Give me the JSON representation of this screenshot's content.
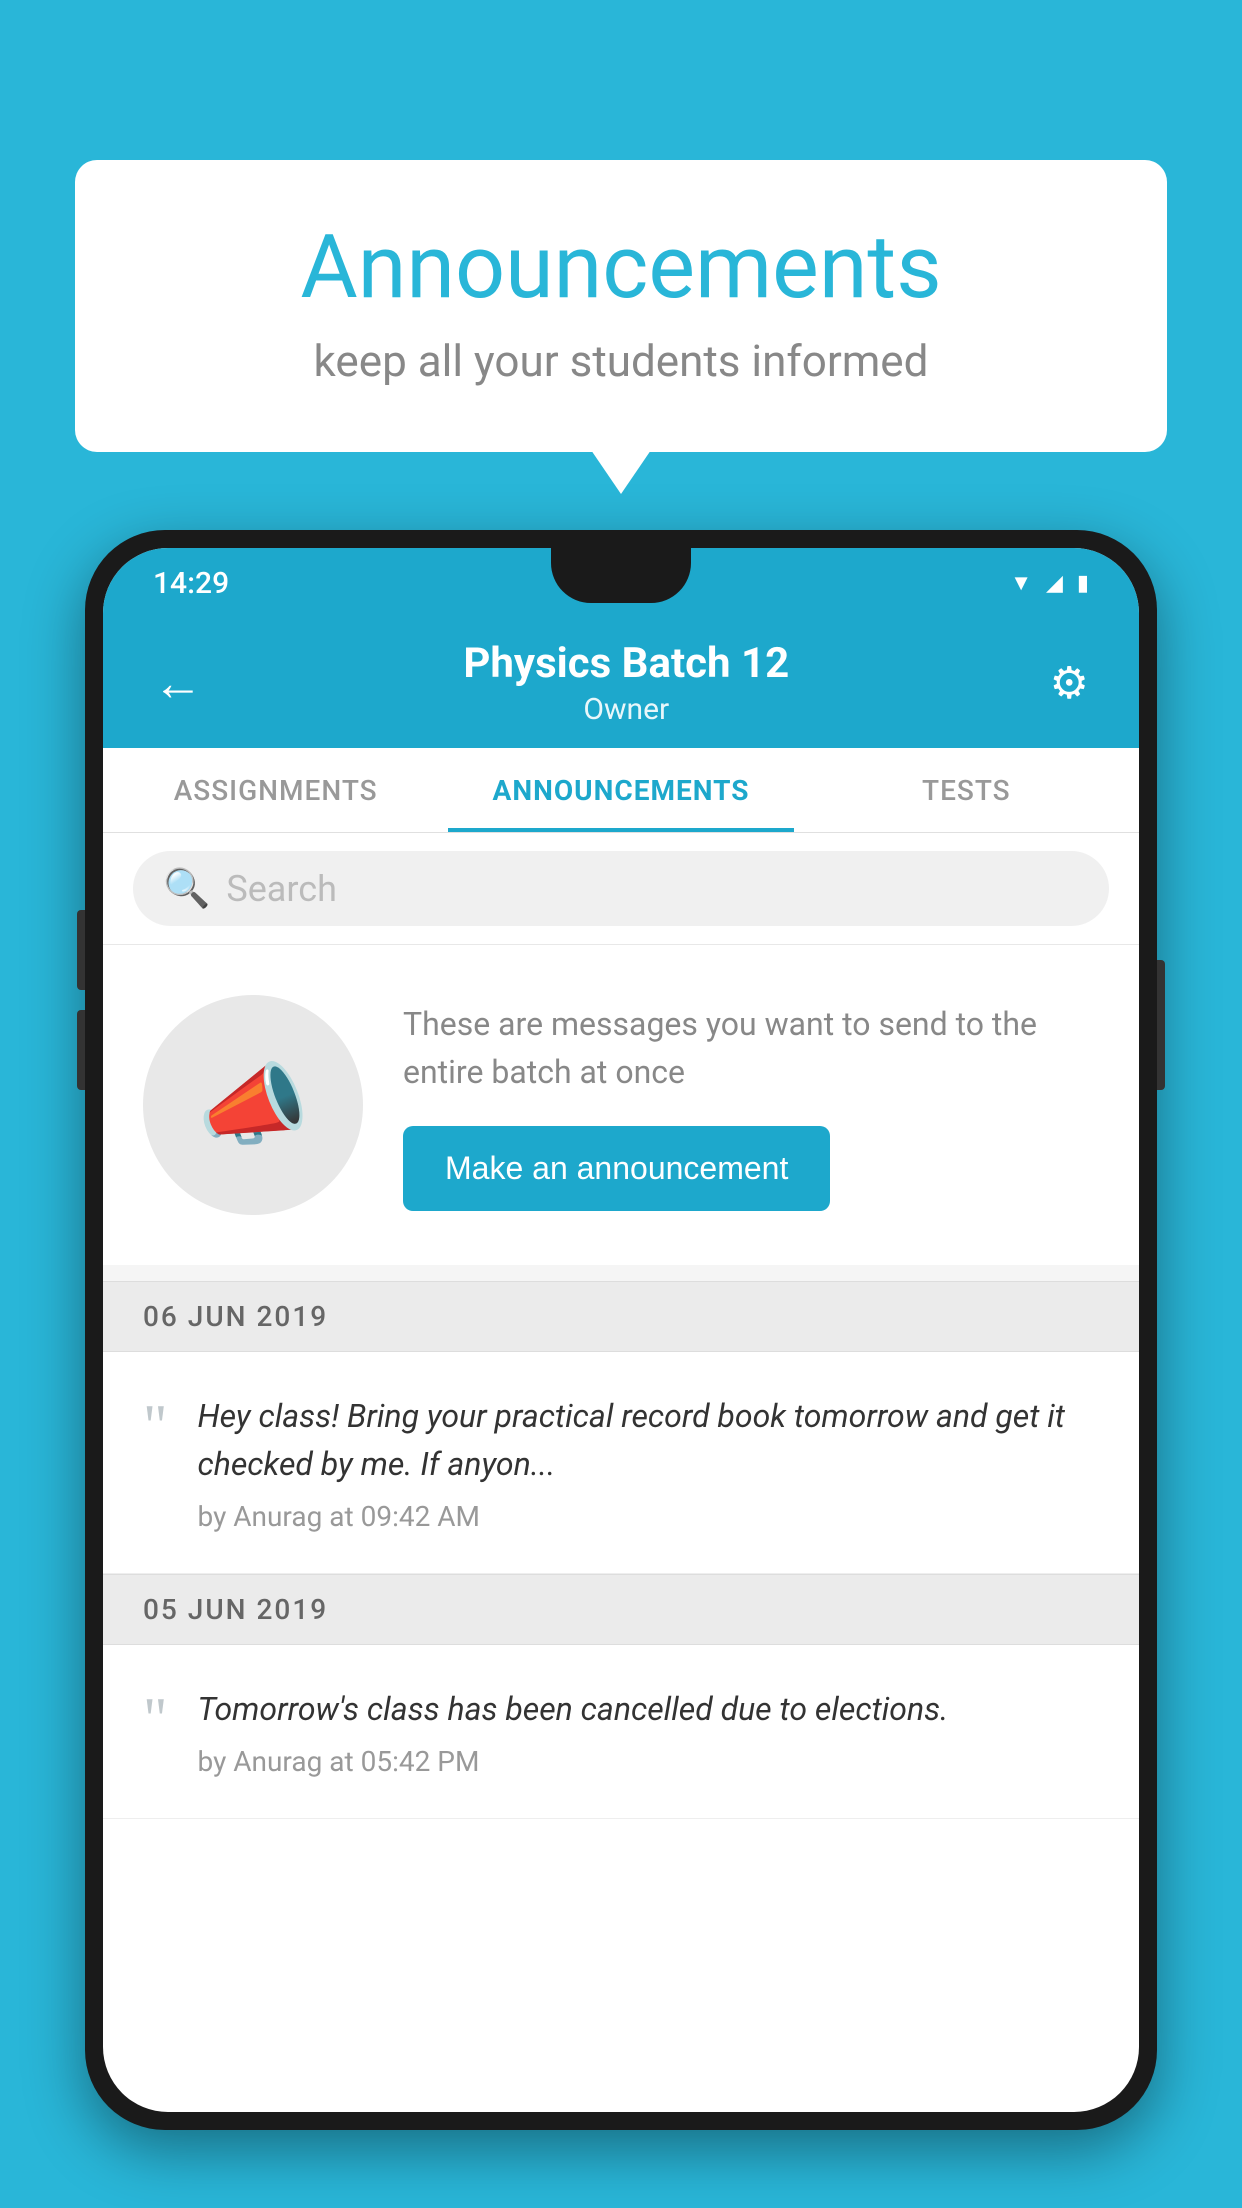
{
  "background_color": "#29b6d8",
  "speech_bubble": {
    "title": "Announcements",
    "subtitle": "keep all your students informed"
  },
  "phone": {
    "status_bar": {
      "time": "14:29",
      "icons": [
        "wifi",
        "signal",
        "battery"
      ]
    },
    "app_bar": {
      "back_label": "←",
      "title": "Physics Batch 12",
      "subtitle": "Owner",
      "settings_label": "⚙"
    },
    "tabs": [
      {
        "label": "ASSIGNMENTS",
        "active": false
      },
      {
        "label": "ANNOUNCEMENTS",
        "active": true
      },
      {
        "label": "TESTS",
        "active": false
      },
      {
        "label": "...",
        "active": false
      }
    ],
    "search": {
      "placeholder": "Search"
    },
    "promo": {
      "description": "These are messages you want to send to the entire batch at once",
      "button_label": "Make an announcement"
    },
    "announcements": [
      {
        "date": "06  JUN  2019",
        "text": "Hey class! Bring your practical record book tomorrow and get it checked by me. If anyon...",
        "meta": "by Anurag at 09:42 AM"
      },
      {
        "date": "05  JUN  2019",
        "text": "Tomorrow's class has been cancelled due to elections.",
        "meta": "by Anurag at 05:42 PM"
      }
    ]
  }
}
